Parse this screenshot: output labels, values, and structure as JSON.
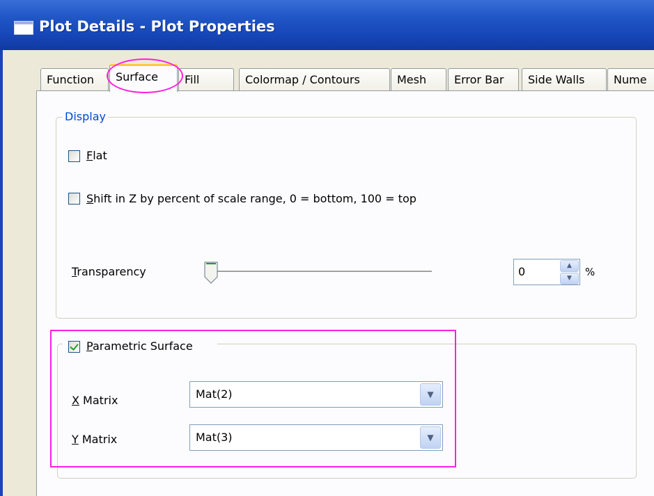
{
  "window": {
    "title": "Plot Details - Plot Properties"
  },
  "tabs": [
    {
      "label": "Function",
      "active": false
    },
    {
      "label": "Surface",
      "active": true
    },
    {
      "label": "Fill",
      "active": false
    },
    {
      "label": "Colormap / Contours",
      "active": false
    },
    {
      "label": "Mesh",
      "active": false
    },
    {
      "label": "Error Bar",
      "active": false
    },
    {
      "label": "Side Walls",
      "active": false
    },
    {
      "label": "Nume",
      "active": false
    }
  ],
  "display": {
    "legend": "Display",
    "flat": {
      "label_underlined": "F",
      "label_rest": "lat",
      "checked": false
    },
    "shift": {
      "label_underlined": "S",
      "label_rest": "hift in Z by percent of scale range, 0 = bottom, 100 = top",
      "checked": false
    },
    "transparency": {
      "label_underlined": "T",
      "label_rest": "ransparency",
      "value": "0",
      "unit": "%",
      "slider_value": 0
    }
  },
  "parametric": {
    "label_underlined": "P",
    "label_rest": "arametric Surface",
    "checked": true,
    "x_matrix": {
      "label_underlined": "X",
      "label_rest": " Matrix",
      "value": "Mat(2)"
    },
    "y_matrix": {
      "label_underlined": "Y",
      "label_rest": " Matrix",
      "value": "Mat(3)"
    }
  },
  "colors": {
    "highlight": "#ff1fe0",
    "title_bar": "#1746b8",
    "group_legend": "#0046d5"
  }
}
